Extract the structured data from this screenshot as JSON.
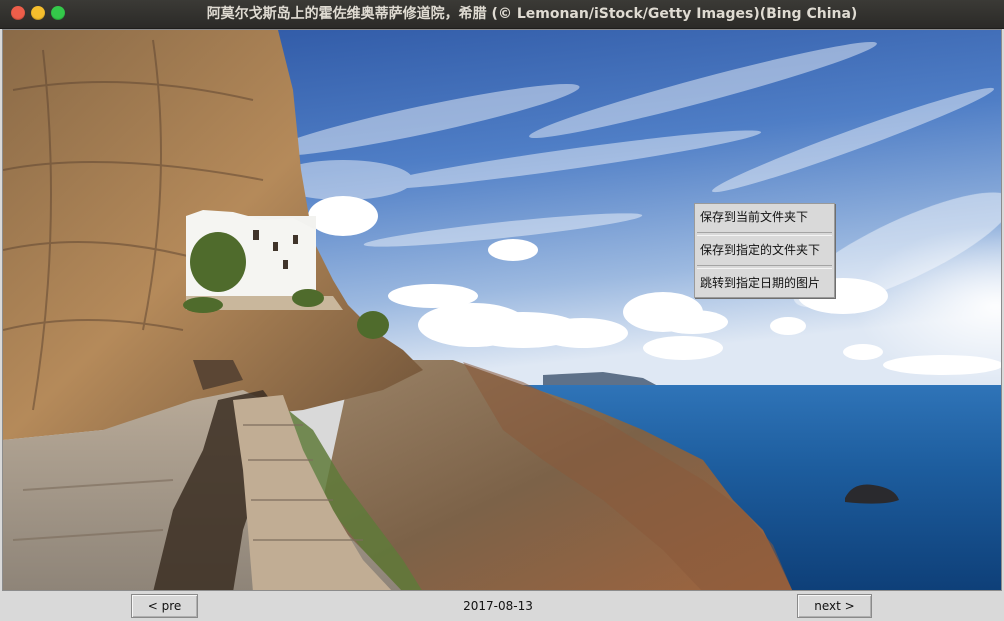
{
  "window": {
    "title": "阿莫尔戈斯岛上的霍佐维奥蒂萨修道院，希腊 (© Lemonan/iStock/Getty Images)(Bing China)"
  },
  "image": {
    "subject": "Monastery of Hozoviotissa on a cliff above the Aegean Sea, Amorgos"
  },
  "context_menu": {
    "items": [
      {
        "label": "保存到当前文件夹下"
      },
      {
        "label": "保存到指定的文件夹下"
      },
      {
        "label": "跳转到指定日期的图片"
      }
    ]
  },
  "bottom_bar": {
    "pre_label": "< pre",
    "date": "2017-08-13",
    "next_label": "next >"
  },
  "colors": {
    "titlebar": "#2f2e2a",
    "close": "#ed5e4a",
    "minimize": "#f5be2d",
    "maximize": "#34c84a",
    "panel": "#d9d9d9"
  }
}
